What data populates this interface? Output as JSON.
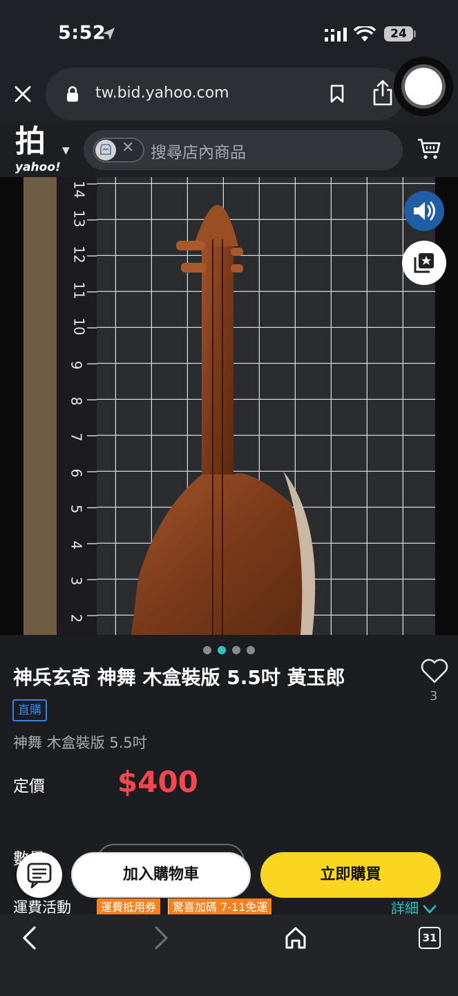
{
  "status_bar": {
    "time": "5:52",
    "battery": "24"
  },
  "browser": {
    "url": "tw.bid.yahoo.com"
  },
  "header": {
    "logo_glyph": "拍",
    "logo_word": "yahoo!",
    "search_placeholder": "搜尋店內商品"
  },
  "product": {
    "image_ruler_numbers": [
      "14",
      "13",
      "12",
      "11",
      "10",
      "9",
      "8",
      "7",
      "6",
      "5",
      "4",
      "3",
      "2"
    ],
    "carousel_count": 4,
    "carousel_active": 1,
    "title": "神兵玄奇 神舞 木盒裝版 5.5吋 黃玉郎",
    "likes": "3",
    "badge": "直購",
    "subtitle": "神舞 木盒裝版 5.5吋",
    "price_label": "定價",
    "price": "$400",
    "quantity_label": "數量"
  },
  "shipping": {
    "label": "運費活動",
    "coupon": "運費抵用券",
    "promo": "驚喜加碼 7-11免運",
    "detail": "詳細"
  },
  "actions": {
    "add_to_cart": "加入購物車",
    "buy_now": "立即購買"
  },
  "nav": {
    "tab_count": "31"
  },
  "colors": {
    "accent_teal": "#2ec4c1",
    "price_red": "#f5474f",
    "buy_yellow": "#fbd620",
    "badge_blue": "#3b82e6",
    "promo_orange": "#f5821f"
  }
}
